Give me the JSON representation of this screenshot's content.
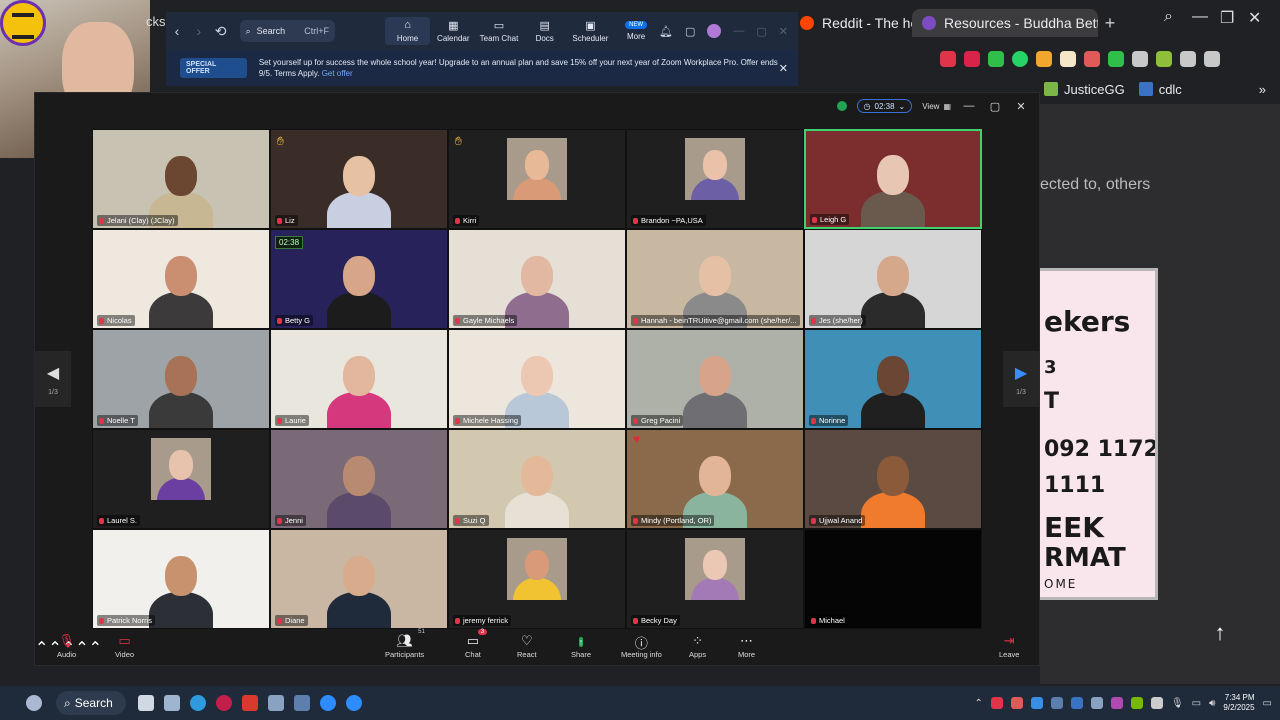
{
  "browser": {
    "tabs": [
      {
        "label": "Reddit - The hea",
        "icon_color": "#ff4500",
        "active": false
      },
      {
        "label": "Resources - Buddha Betty",
        "icon_color": "#7d4cc2",
        "active": true
      }
    ],
    "new_tab": "+",
    "bookmarks": [
      "JusticeGG",
      "cdlc"
    ],
    "page_text": "ected to, others",
    "poster_lines": [
      "ekers",
      "3",
      "T",
      "092 1172",
      "1111",
      "EEK",
      "RMAT",
      "OME"
    ]
  },
  "zoom_main": {
    "search_label": "Search",
    "search_shortcut": "Ctrl+F",
    "nav": [
      {
        "label": "Home",
        "icon": "house-icon",
        "active": true
      },
      {
        "label": "Calendar",
        "icon": "calendar-icon"
      },
      {
        "label": "Team Chat",
        "icon": "chat-icon"
      },
      {
        "label": "Docs",
        "icon": "doc-icon"
      },
      {
        "label": "Scheduler",
        "icon": "scheduler-icon"
      },
      {
        "label": "More",
        "icon": "more-icon",
        "badge": "NEW"
      }
    ],
    "offer": {
      "badge": "SPECIAL OFFER",
      "text": "Set yourself up for success the whole school year! Upgrade to an annual plan and save 15% off your next year of Zoom Workplace Pro. Offer ends 9/5. Terms Apply.",
      "link": "Get offer"
    }
  },
  "selfview": {
    "label_fragment": "cks"
  },
  "meeting": {
    "timer": "02:38",
    "view_label": "View",
    "page": "1/3",
    "participants": [
      {
        "name": "Jelani (Clay) (JClay)",
        "bg": "#c8c2b2",
        "skin": "#6b4630",
        "shirt": "#c7b893"
      },
      {
        "name": "Liz",
        "bg": "#3a2d28",
        "skin": "#e7c1a3",
        "shirt": "#c7cfe0",
        "hand": true
      },
      {
        "name": "Kirri",
        "bg": "#1f1f1f",
        "skin": "#e8b997",
        "shirt": "#d99a78",
        "hand": true,
        "inset": true
      },
      {
        "name": "Brandon ~PA,USA",
        "bg": "#1f1f1f",
        "skin": "#e9c2a9",
        "shirt": "#6c5fa6",
        "inset": true
      },
      {
        "name": "Leigh G",
        "bg": "#7c2e2e",
        "skin": "#e7c7b3",
        "shirt": "#6a5a4e",
        "speaking": true
      },
      {
        "name": "Nicolas",
        "bg": "#efe8df",
        "skin": "#c98f70",
        "shirt": "#3c3a3a"
      },
      {
        "name": "Betty G",
        "bg": "#27235a",
        "skin": "#d7a587",
        "shirt": "#1c1c1c",
        "timer": true
      },
      {
        "name": "Gayle Michaels",
        "bg": "#e6dfd5",
        "skin": "#e2b8a2",
        "shirt": "#8e6d8e"
      },
      {
        "name": "Hannah - beinTRUitive@gmail.com (she/her/...",
        "bg": "#c8b8a2",
        "skin": "#e5c0a4",
        "shirt": "#8a8a8a"
      },
      {
        "name": "Jes (she/her)",
        "bg": "#d6d6d6",
        "skin": "#d6a88b",
        "shirt": "#2b2b2b"
      },
      {
        "name": "Noelle T",
        "bg": "#9ea3a8",
        "skin": "#a87256",
        "shirt": "#3b3a3a"
      },
      {
        "name": "Laurie",
        "bg": "#e9e6dd",
        "skin": "#e2b79d",
        "shirt": "#d5387d"
      },
      {
        "name": "Michele Hassing",
        "bg": "#ede6dc",
        "skin": "#ecc7b2",
        "shirt": "#b9c8d9"
      },
      {
        "name": "Greg Pacini",
        "bg": "#aeb1a8",
        "skin": "#d7a38b",
        "shirt": "#6e6e73"
      },
      {
        "name": "Norinne",
        "bg": "#3f8fb7",
        "skin": "#6b4634",
        "shirt": "#202020"
      },
      {
        "name": "Laurel S.",
        "bg": "#1f1f1f",
        "skin": "#e7c2ac",
        "shirt": "#6b3fa2",
        "inset": true
      },
      {
        "name": "Jenni",
        "bg": "#7a6a78",
        "skin": "#b98a72",
        "shirt": "#5b4a6a"
      },
      {
        "name": "Suzi Q",
        "bg": "#d2c8b0",
        "skin": "#e4b999",
        "shirt": "#e7e1d5"
      },
      {
        "name": "Mindy (Portland, OR)",
        "bg": "#8a6a4b",
        "skin": "#e2b596",
        "shirt": "#8ab49e",
        "heart": true
      },
      {
        "name": "Ujjwal Anand",
        "bg": "#5a4a42",
        "skin": "#8a5a3a",
        "shirt": "#f07b2c"
      },
      {
        "name": "Patrick Norris",
        "bg": "#f2f0ed",
        "skin": "#c8926f",
        "shirt": "#2c2f35"
      },
      {
        "name": "Diane",
        "bg": "#c9b7a4",
        "skin": "#d8ab8c",
        "shirt": "#1f2a3a"
      },
      {
        "name": "jeremy ferrick",
        "bg": "#1f1f1f",
        "skin": "#d89a78",
        "shirt": "#f1c232",
        "inset": true
      },
      {
        "name": "Becky Day",
        "bg": "#1f1f1f",
        "skin": "#ebc8b4",
        "shirt": "#a37ab6",
        "inset": true
      },
      {
        "name": "Michael",
        "bg": "#050505",
        "skin": "#050505",
        "shirt": "#050505",
        "empty": true
      }
    ],
    "toolbar": {
      "audio": "Audio",
      "video": "Video",
      "participants": "Participants",
      "participants_count": "51",
      "chat": "Chat",
      "chat_badge": "3",
      "react": "React",
      "share": "Share",
      "meeting_info": "Meeting info",
      "apps": "Apps",
      "more": "More",
      "leave": "Leave"
    }
  },
  "taskbar": {
    "search": "Search",
    "time": "7:34 PM",
    "date": "9/2/2025"
  },
  "colors": {
    "accent": "#0e71eb",
    "speaking": "#3fd26f",
    "muted_red": "#e0344a",
    "share_green": "#23a455"
  }
}
